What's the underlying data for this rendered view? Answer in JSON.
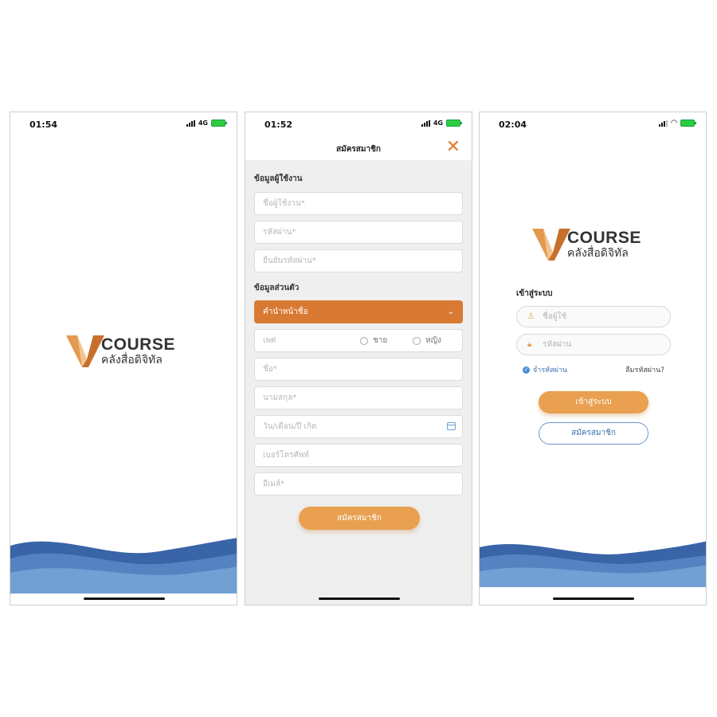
{
  "brand": {
    "course": "COURSE",
    "tagline": "คลังสื่อดิจิทัล"
  },
  "screens": {
    "splash": {
      "time": "01:54",
      "network": "4G"
    },
    "register": {
      "time": "01:52",
      "network": "4G",
      "title": "สมัครสมาชิก",
      "section_user": "ข้อมูลผู้ใช้งาน",
      "section_personal": "ข้อมูลส่วนตัว",
      "fields": {
        "username": "ชื่อผู้ใช้งาน*",
        "password": "รหัสผ่าน*",
        "confirm_password": "ยืนยันรหัสผ่าน*",
        "prefix": "คำนำหน้าชื่อ",
        "gender": "เพศ",
        "male": "ชาย",
        "female": "หญิง",
        "first_name": "ชื่อ*",
        "last_name": "นามสกุล*",
        "birthdate": "วัน/เดือน/ปี เกิด",
        "phone": "เบอร์โทรศัพท์",
        "email": "อีเมล์*"
      },
      "submit": "สมัครสมาชิก"
    },
    "login": {
      "time": "02:04",
      "title": "เข้าสู่ระบบ",
      "username": "ชื่อผู้ใช้",
      "password": "รหัสผ่าน",
      "remember": "จำรหัสผ่าน",
      "forgot": "ลืมรหัสผ่าน?",
      "login_button": "เข้าสู่ระบบ",
      "register_button": "สมัครสมาชิก"
    }
  },
  "colors": {
    "accent_orange": "#d87a34",
    "button_orange": "#e9a050",
    "wave_blue": "#3d6db0",
    "link_blue": "#3d6fb3"
  }
}
